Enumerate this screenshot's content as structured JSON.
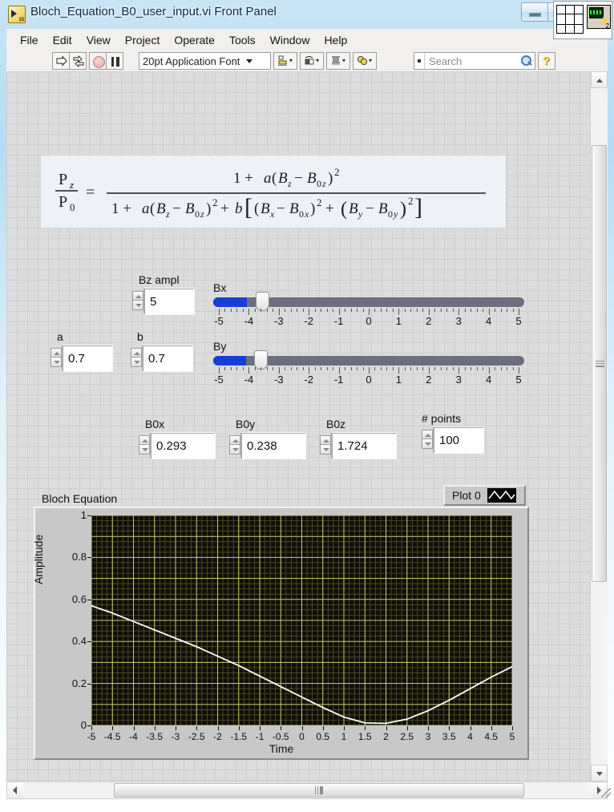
{
  "window": {
    "title": "Bloch_Equation_B0_user_input.vi Front Panel",
    "icon_badge": "15",
    "minimize_label": "",
    "maximize_label": "",
    "close_label": "✕"
  },
  "menu": {
    "items": [
      "File",
      "Edit",
      "View",
      "Project",
      "Operate",
      "Tools",
      "Window",
      "Help"
    ]
  },
  "toolbar": {
    "run_icon": "run-arrow-icon",
    "run_continuously_icon": "run-continuously-icon",
    "abort_icon": "abort-execution-icon",
    "pause_icon": "pause-icon",
    "font_label": "20pt Application Font",
    "align_icon": "align-objects-icon",
    "distribute_icon": "distribute-objects-icon",
    "resize_icon": "resize-objects-icon",
    "reorder_icon": "reorder-objects-icon",
    "search_placeholder": "Search",
    "search_value": "",
    "help_label": "?"
  },
  "vi_icon": {
    "connector_label": "connector-pane",
    "glyph_number": "2"
  },
  "formula": {
    "lhs_num": "P",
    "lhs_num_sub": "z",
    "lhs_den": "P",
    "lhs_den_sub": "0",
    "equals": "=",
    "numerator": "1 + a(B_z − B_0z)²",
    "denominator": "1 + a(B_z − B_0z)² + b[(B_x − B_0x)² + (B_y − B_0y)²]"
  },
  "controls": {
    "bz_ampl": {
      "label": "Bz ampl",
      "value": "5"
    },
    "a": {
      "label": "a",
      "value": "0.7"
    },
    "b": {
      "label": "b",
      "value": "0.7"
    },
    "b0x": {
      "label": "B0x",
      "value": "0.293"
    },
    "b0y": {
      "label": "B0y",
      "value": "0.238"
    },
    "b0z": {
      "label": "B0z",
      "value": "1.724"
    },
    "num_points": {
      "label": "# points",
      "value": "100"
    }
  },
  "sliders": [
    {
      "label": "Bx",
      "value": -3.9,
      "min": -5,
      "max": 5,
      "tick_labels": [
        "-5",
        "-4",
        "-3",
        "-2",
        "-1",
        "0",
        "1",
        "2",
        "3",
        "4",
        "5"
      ],
      "fill_color": "#1540d8",
      "track_color": "#6e6e82"
    },
    {
      "label": "By",
      "value": -3.95,
      "min": -5,
      "max": 5,
      "tick_labels": [
        "-5",
        "-4",
        "-3",
        "-2",
        "-1",
        "0",
        "1",
        "2",
        "3",
        "4",
        "5"
      ],
      "fill_color": "#1540d8",
      "track_color": "#6e6e82"
    }
  ],
  "graph": {
    "title": "Bloch Equation",
    "legend_label": "Plot 0",
    "legend_icon": "plot-waveform-icon"
  },
  "chart_data": {
    "type": "line",
    "title": "Bloch Equation",
    "xlabel": "Time",
    "ylabel": "Amplitude",
    "xlim": [
      -5,
      5
    ],
    "ylim": [
      0,
      1
    ],
    "grid": true,
    "legend_position": "top-right",
    "plot_bg": "#100f06",
    "grid_color": "#c8c86e",
    "line_color": "#ffffff",
    "xticks": [
      "-5",
      "-4.5",
      "-4",
      "-3.5",
      "-3",
      "-2.5",
      "-2",
      "-1.5",
      "-1",
      "-0.5",
      "0",
      "0.5",
      "1",
      "1.5",
      "2",
      "2.5",
      "3",
      "3.5",
      "4",
      "4.5",
      "5"
    ],
    "yticks": [
      "0",
      "0.2",
      "0.4",
      "0.6",
      "0.8",
      "1"
    ],
    "series": [
      {
        "name": "Plot 0",
        "x": [
          -5,
          -4.5,
          -4,
          -3.5,
          -3,
          -2.5,
          -2,
          -1.5,
          -1,
          -0.5,
          0,
          0.5,
          1,
          1.5,
          2,
          2.5,
          3,
          3.5,
          4,
          4.5,
          5
        ],
        "y": [
          0.57,
          0.535,
          0.495,
          0.455,
          0.415,
          0.375,
          0.33,
          0.285,
          0.235,
          0.185,
          0.135,
          0.085,
          0.04,
          0.012,
          0.01,
          0.03,
          0.07,
          0.12,
          0.175,
          0.23,
          0.28
        ]
      }
    ]
  }
}
